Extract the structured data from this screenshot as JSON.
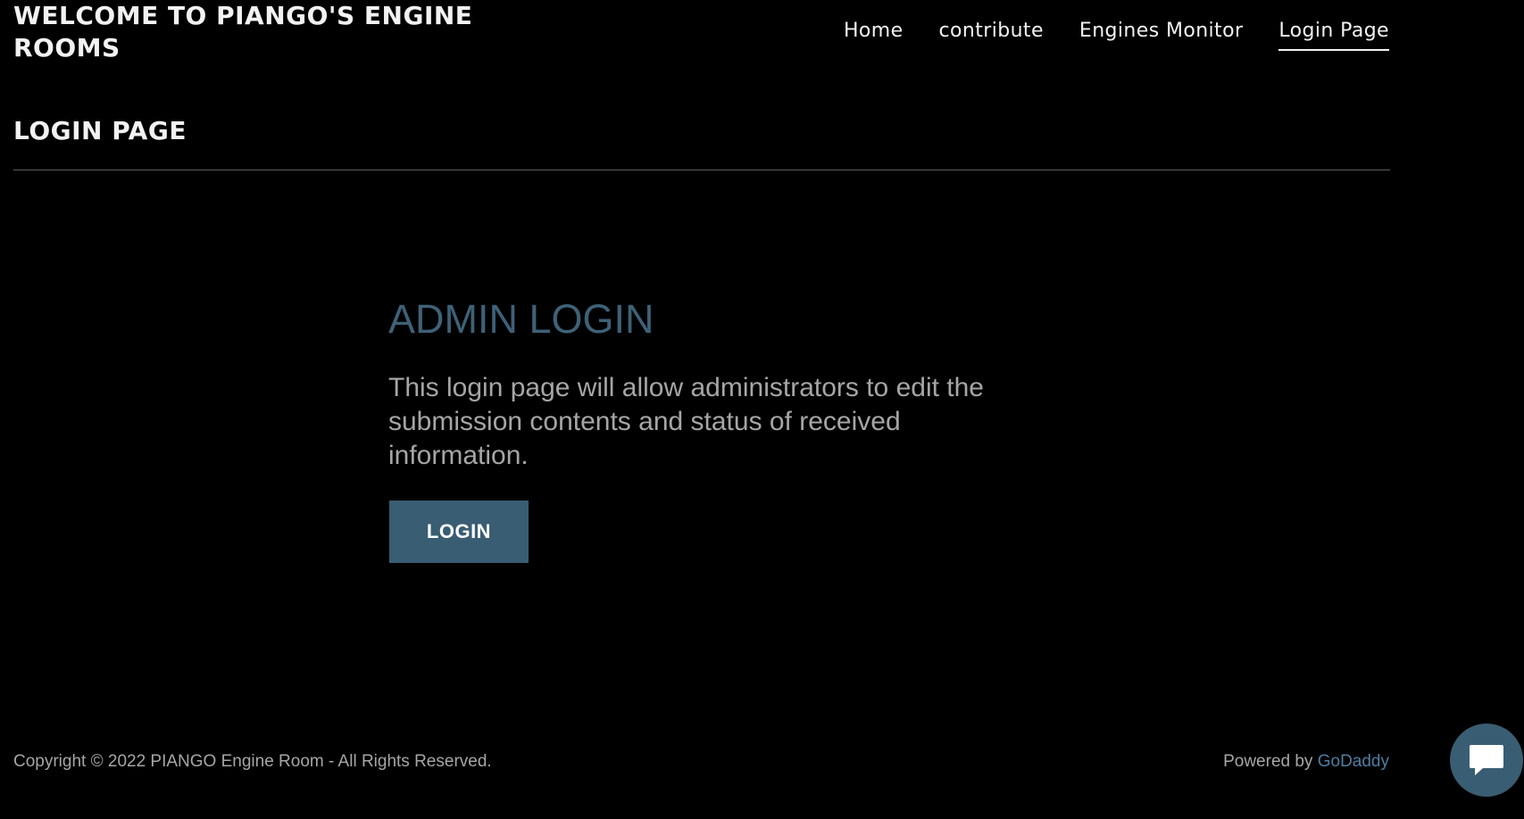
{
  "header": {
    "title": "WELCOME TO PIANGO'S ENGINE ROOMS",
    "nav": [
      {
        "label": "Home",
        "active": false
      },
      {
        "label": "contribute",
        "active": false
      },
      {
        "label": "Engines Monitor",
        "active": false
      },
      {
        "label": "Login Page",
        "active": true
      }
    ]
  },
  "page": {
    "title": "LOGIN PAGE"
  },
  "admin": {
    "heading": "ADMIN LOGIN",
    "description": "This login page will allow administrators to edit the submission contents and status of received information.",
    "login_label": "LOGIN"
  },
  "footer": {
    "copyright": "Copyright © 2022 PIANGO Engine Room - All Rights Reserved.",
    "powered_prefix": "Powered by",
    "powered_link": "GoDaddy"
  },
  "chat": {
    "icon": "chat-bubble-icon"
  },
  "colors": {
    "background": "#000000",
    "accent": "#395d72",
    "heading_accent": "#3e6177",
    "link": "#4f7ea1",
    "body_text": "#a6a6a6"
  }
}
